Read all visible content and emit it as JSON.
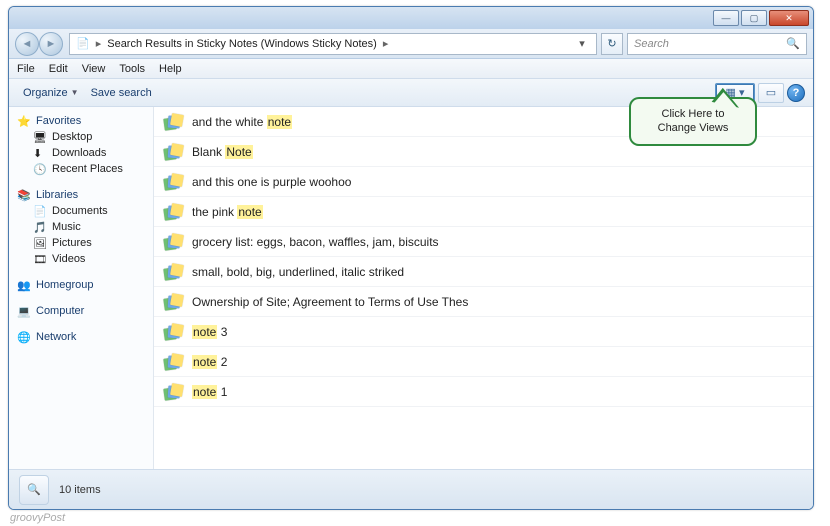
{
  "titlebar": {
    "min": "—",
    "max": "▢",
    "close": "✕"
  },
  "nav": {
    "back": "◄",
    "fwd": "►",
    "crumb1": "Search Results in Sticky Notes (Windows Sticky Notes)",
    "crumbsep": "▸",
    "dropdown": "▾",
    "refresh": "↻",
    "search_placeholder": "Search",
    "search_glyph": "🔍"
  },
  "menu": {
    "file": "File",
    "edit": "Edit",
    "view": "View",
    "tools": "Tools",
    "help": "Help"
  },
  "toolbar": {
    "organize": "Organize",
    "save_search": "Save search",
    "views_glyph": "▦ ▾",
    "preview_glyph": "▭",
    "help_glyph": "?"
  },
  "sidebar": {
    "favorites": "Favorites",
    "fav_items": [
      "Desktop",
      "Downloads",
      "Recent Places"
    ],
    "libraries": "Libraries",
    "lib_items": [
      "Documents",
      "Music",
      "Pictures",
      "Videos"
    ],
    "homegroup": "Homegroup",
    "computer": "Computer",
    "network": "Network"
  },
  "results": [
    {
      "pre": "and the white ",
      "hl": "note",
      "post": ""
    },
    {
      "pre": "Blank ",
      "hl": "Note",
      "post": ""
    },
    {
      "pre": "and this one is purple woohoo",
      "hl": "",
      "post": ""
    },
    {
      "pre": "the pink ",
      "hl": "note",
      "post": ""
    },
    {
      "pre": "grocery list: eggs, bacon, waffles, jam, biscuits",
      "hl": "",
      "post": ""
    },
    {
      "pre": "small, bold,  big,  underlined, italic striked",
      "hl": "",
      "post": ""
    },
    {
      "pre": "Ownership of Site; Agreement to Terms of Use Thes",
      "hl": "",
      "post": ""
    },
    {
      "pre": "",
      "hl": "note",
      "post": " 3"
    },
    {
      "pre": "",
      "hl": "note",
      "post": " 2"
    },
    {
      "pre": "",
      "hl": "note",
      "post": " 1"
    }
  ],
  "callout": {
    "line1": "Click Here to",
    "line2": "Change Views"
  },
  "status": {
    "count": "10 items",
    "icon": "🔍"
  },
  "watermark": "groovyPost"
}
